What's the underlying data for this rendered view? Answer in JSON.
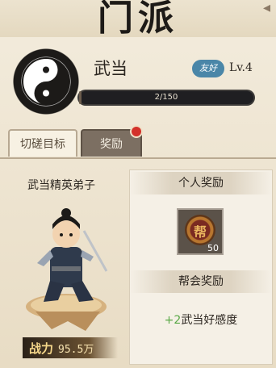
{
  "title": "门派",
  "header": {
    "sect_name": "武当",
    "friend_badge": "友好",
    "level": "Lv.4",
    "progress_text": "2/150",
    "progress_value": 2,
    "progress_max": 150
  },
  "tabs": [
    {
      "label": "切磋目标",
      "active": true
    },
    {
      "label": "奖励",
      "active": false,
      "has_notification": true
    }
  ],
  "target": {
    "name": "武当精英弟子",
    "power_label": "战力",
    "power_value": "95.5万"
  },
  "rewards": {
    "personal_header": "个人奖励",
    "item_icon": "coin-icon",
    "item_char": "帮",
    "item_count": "50",
    "faction_header": "帮会奖励",
    "faction_bonus_amount": "+2",
    "faction_bonus_text": "武当好感度"
  },
  "colors": {
    "accent_blue": "#4a86a8",
    "notification_red": "#d3312a",
    "bonus_green": "#59a846"
  }
}
